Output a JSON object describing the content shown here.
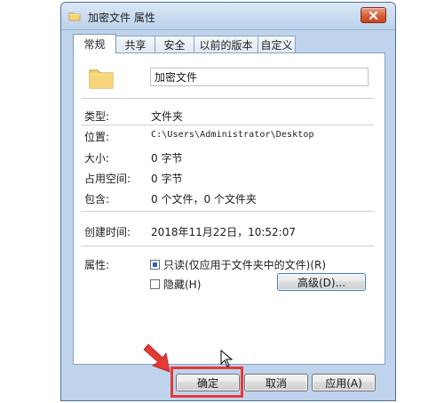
{
  "window": {
    "title": "加密文件 属性"
  },
  "tabs": [
    {
      "label": "常规",
      "active": true
    },
    {
      "label": "共享",
      "active": false
    },
    {
      "label": "安全",
      "active": false
    },
    {
      "label": "以前的版本",
      "active": false
    },
    {
      "label": "自定义",
      "active": false
    }
  ],
  "general": {
    "name_value": "加密文件",
    "type_label": "类型:",
    "type_value": "文件夹",
    "location_label": "位置:",
    "location_value": "C:\\Users\\Administrator\\Desktop",
    "size_label": "大小:",
    "size_value": "0 字节",
    "size_on_disk_label": "占用空间:",
    "size_on_disk_value": "0 字节",
    "contains_label": "包含:",
    "contains_value": "0 个文件，0 个文件夹",
    "created_label": "创建时间:",
    "created_value": "2018年11月22日，10:52:07",
    "attributes_label": "属性:",
    "readonly_label": "只读(仅应用于文件夹中的文件)(R)",
    "readonly_state": "indeterminate",
    "hidden_label": "隐藏(H)",
    "hidden_state": "unchecked",
    "advanced_button": "高级(D)..."
  },
  "buttons": {
    "ok": "确定",
    "cancel": "取消",
    "apply": "应用(A)"
  },
  "colors": {
    "title_bar": "#c9dbf0",
    "close_button": "#d85d35",
    "highlight_box": "#e53935",
    "folder_yellow": "#f3cf6a"
  },
  "icons": {
    "title": "folder-icon",
    "main": "folder-icon",
    "close": "close-icon",
    "cursor": "mouse-cursor-icon",
    "annotation": "red-arrow-icon"
  }
}
